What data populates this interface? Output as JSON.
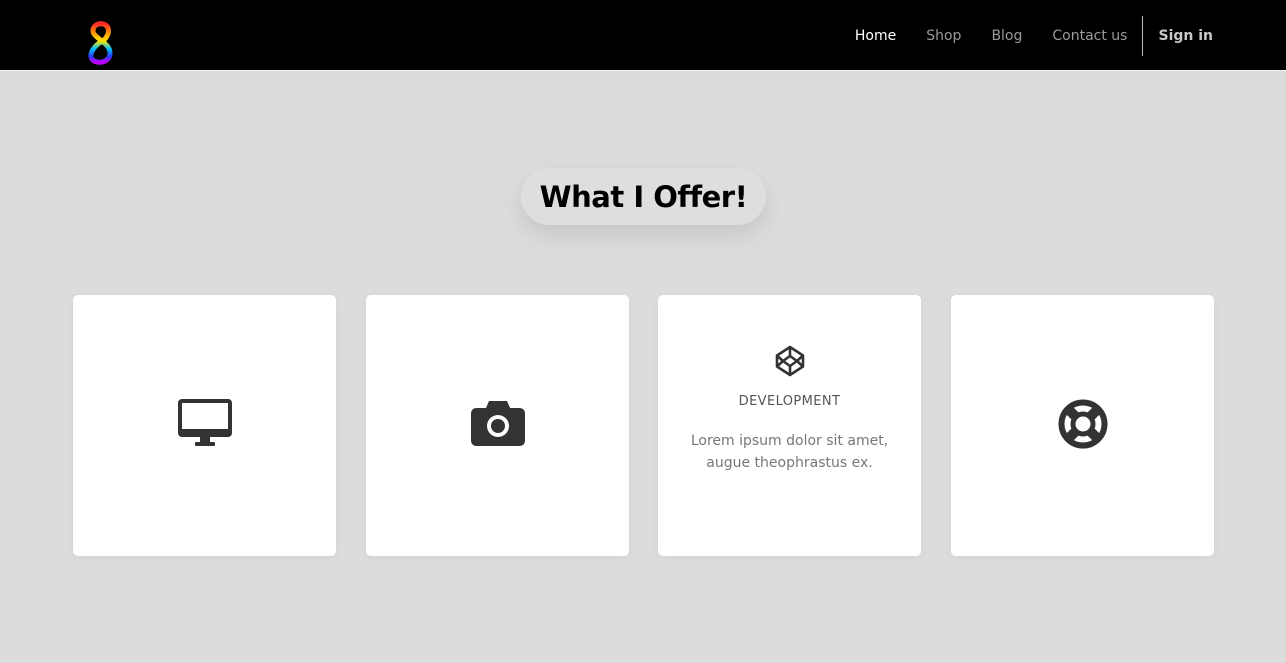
{
  "navbar": {
    "logo_icon": "rainbow-s-logo-icon",
    "links": [
      {
        "label": "Home",
        "active": true
      },
      {
        "label": "Shop",
        "active": false
      },
      {
        "label": "Blog",
        "active": false
      },
      {
        "label": "Contact us",
        "active": false
      }
    ],
    "sign_in_label": "Sign in"
  },
  "section": {
    "title": "What I Offer!"
  },
  "cards": [
    {
      "icon": "desktop-icon"
    },
    {
      "icon": "camera-icon"
    },
    {
      "icon": "codepen-icon",
      "title": "DEVELOPMENT",
      "description": "Lorem ipsum dolor sit amet, augue theophrastus ex."
    },
    {
      "icon": "life-ring-icon"
    }
  ],
  "colors": {
    "navbar_bg": "#000000",
    "page_bg": "#dcdcdc",
    "card_bg": "#ffffff",
    "icon_color": "#333333"
  }
}
